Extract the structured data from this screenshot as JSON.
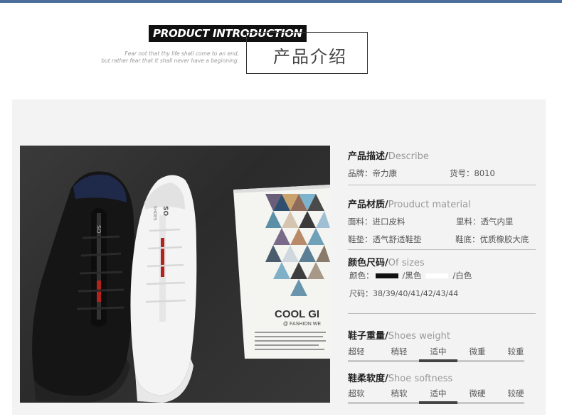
{
  "header": {
    "title_en": "PRODUCT INTRODUCTION",
    "title_cn": "产品介绍",
    "quote_line1": "Fear not that thy life shall come to an end,",
    "quote_line2": "but rather fear that it shall never have a beginning."
  },
  "photo": {
    "magazine_title": "COOL GI",
    "magazine_subtitle": "@ FASHION WE",
    "shoe_tongue_text": "SO",
    "shoe_tongue_sub": "SHOES"
  },
  "describe": {
    "title_cn": "产品描述/",
    "title_en": "Describe",
    "brand": "品牌：帝力康",
    "item_no": "货号：8010"
  },
  "material": {
    "title_cn": "产品材质/",
    "title_en": "Prouduct material",
    "upper": "面料：进口皮料",
    "lining": "里料：透气内里",
    "insole": "鞋垫：透气舒适鞋垫",
    "sole": "鞋底：优质橡胶大底"
  },
  "sizes": {
    "title_cn": "颜色尺码/",
    "title_en": "Of sizes",
    "color_prefix": "颜色：",
    "color_black": "/黑色",
    "color_white": "/白色",
    "sizes_text": "尺码：38/39/40/41/42/43/44"
  },
  "weight": {
    "title_cn": "鞋子重量/",
    "title_en": "Shoes weight",
    "labels": [
      "超轻",
      "稍轻",
      "适中",
      "微重",
      "较重"
    ],
    "selected": "适中"
  },
  "softness": {
    "title_cn": "鞋柔软度/",
    "title_en": "Shoe softness",
    "labels": [
      "超软",
      "稍软",
      "适中",
      "微硬",
      "较硬"
    ],
    "selected": "适中"
  },
  "colors": {
    "topbar": "#4c6e9a",
    "panel": "#f3f3f3",
    "bar_active": "#444444",
    "bar_inactive": "#c8c8c8"
  }
}
